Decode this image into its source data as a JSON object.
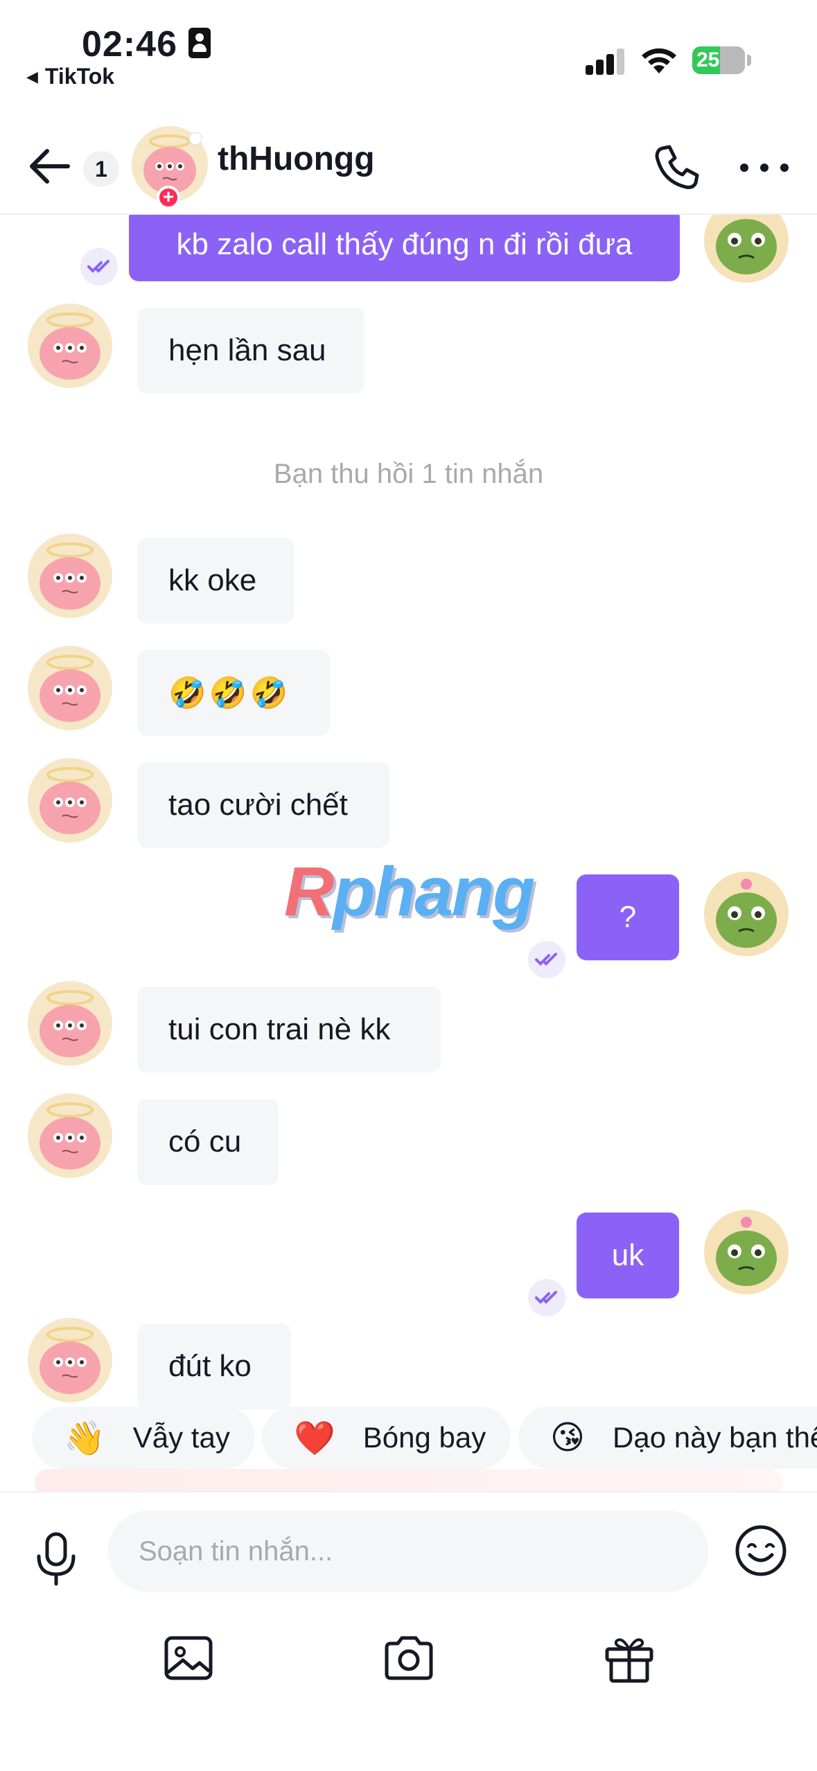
{
  "status_bar": {
    "time": "02:46",
    "back_app": "TikTok",
    "battery": "25"
  },
  "header": {
    "unread_count": "1",
    "contact_name": "thHuongg"
  },
  "messages": [
    {
      "id": "m1",
      "side": "out",
      "text": "kb zalo call thấy đúng n đi rồi đưa"
    },
    {
      "id": "m2",
      "side": "in",
      "text": "hẹn lần sau"
    },
    {
      "id": "m3",
      "side": "system",
      "text": "Bạn thu hồi 1 tin nhắn"
    },
    {
      "id": "m4",
      "side": "in",
      "text": "kk oke"
    },
    {
      "id": "m5",
      "side": "in",
      "text": "🤣🤣🤣"
    },
    {
      "id": "m6",
      "side": "in",
      "text": "tao cười chết"
    },
    {
      "id": "m7",
      "side": "out",
      "text": "?"
    },
    {
      "id": "m8",
      "side": "in",
      "text": "tui con trai nè kk"
    },
    {
      "id": "m9",
      "side": "in",
      "text": "có cu"
    },
    {
      "id": "m10",
      "side": "out",
      "text": "uk"
    },
    {
      "id": "m11",
      "side": "in",
      "text": "đút ko"
    }
  ],
  "watermark": {
    "first": "R",
    "rest": "phang"
  },
  "quick_replies": [
    {
      "emoji": "👋",
      "label": "Vẫy tay"
    },
    {
      "emoji": "❤️",
      "label": "Bóng bay"
    },
    {
      "emoji": "😘",
      "label": "Dạo này bạn thế nào?"
    }
  ],
  "composer": {
    "placeholder": "Soạn tin nhắn..."
  },
  "icons": {
    "back": "arrow-left-icon",
    "call": "phone-icon",
    "more": "more-horizontal-icon",
    "mic": "microphone-icon",
    "emoji": "smiley-icon",
    "image": "image-icon",
    "camera": "camera-icon",
    "gift": "gift-icon",
    "seen": "double-check-icon"
  },
  "colors": {
    "outgoing_bubble": "#8b62f5",
    "incoming_bubble": "#f5f6f7",
    "accent_badge": "#fe2c55",
    "system_text": "#a8a9ae"
  }
}
